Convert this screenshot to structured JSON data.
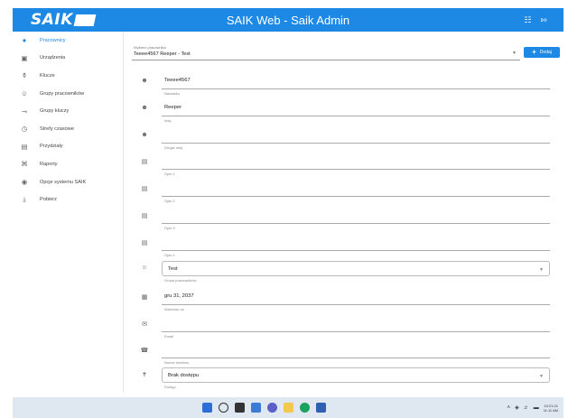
{
  "app": {
    "logo": "SAIK",
    "title": "SAIK Web - Saik Admin",
    "header_icons": [
      "grid-icon",
      "logout-icon"
    ]
  },
  "sidebar": {
    "items": [
      {
        "label": "Pracownicy",
        "icon": "account-circle-icon",
        "active": true
      },
      {
        "label": "Urządzenia",
        "icon": "devices-icon",
        "active": false
      },
      {
        "label": "Klucze",
        "icon": "key-icon",
        "active": false
      },
      {
        "label": "Grupy pracowników",
        "icon": "group-icon",
        "active": false
      },
      {
        "label": "Grupy kluczy",
        "icon": "key-group-icon",
        "active": false
      },
      {
        "label": "Strefy czasowe",
        "icon": "clock-icon",
        "active": false
      },
      {
        "label": "Przydziały",
        "icon": "assignment-icon",
        "active": false
      },
      {
        "label": "Raporty",
        "icon": "report-icon",
        "active": false
      },
      {
        "label": "Opcje systemu SAIK",
        "icon": "settings-icon",
        "active": false
      },
      {
        "label": "Pobierz",
        "icon": "download-icon",
        "active": false
      }
    ]
  },
  "employee_select": {
    "label": "Wybierz pracownika",
    "value": "Teeee4567 Reeper - Test"
  },
  "add_button": {
    "label": "Dodaj"
  },
  "fields": [
    {
      "icon": "person-icon",
      "value": "Teeee4567",
      "hint": "Nazwisko",
      "type": "text"
    },
    {
      "icon": "person-icon",
      "value": "Reeper",
      "hint": "Imię",
      "type": "text"
    },
    {
      "icon": "person-icon",
      "value": "",
      "hint": "Drugie imię",
      "type": "text"
    },
    {
      "icon": "document-icon",
      "value": "",
      "hint": "Opis 1",
      "type": "text"
    },
    {
      "icon": "document-icon",
      "value": "",
      "hint": "Opis 2",
      "type": "text"
    },
    {
      "icon": "document-icon",
      "value": "",
      "hint": "Opis 3",
      "type": "text"
    },
    {
      "icon": "document-icon",
      "value": "",
      "hint": "Opis 4",
      "type": "text"
    },
    {
      "icon": "group-icon",
      "value": "Test",
      "hint": "Grupa pracowników",
      "type": "select"
    },
    {
      "icon": "calendar-icon",
      "value": "gru 31, 2037",
      "hint": "Ważność do",
      "type": "text"
    },
    {
      "icon": "email-icon",
      "value": "",
      "hint": "Email",
      "type": "text"
    },
    {
      "icon": "phone-icon",
      "value": "",
      "hint": "Numer telefonu",
      "type": "text"
    },
    {
      "icon": "accessibility-icon",
      "value": "Brak dostępu",
      "hint": "Dostęp",
      "type": "select"
    }
  ],
  "taskbar": {
    "icons": [
      "start-icon",
      "search-icon",
      "task-view-icon",
      "widgets-icon",
      "chat-icon",
      "file-explorer-icon",
      "chrome-icon",
      "store-icon"
    ],
    "time": "10:21:21",
    "date": "11:11 AM"
  }
}
